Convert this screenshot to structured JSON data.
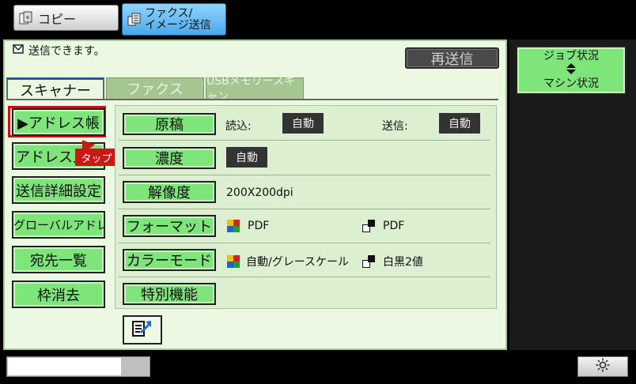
{
  "modes": {
    "copy_label": "コピー",
    "send_label_line1": "ファクス/",
    "send_label_line2": "イメージ送信"
  },
  "status": {
    "message": "送信できます。",
    "resend_label": "再送信"
  },
  "tabs": [
    {
      "label": "スキャナー",
      "active": true
    },
    {
      "label": "ファクス",
      "active": false
    },
    {
      "label": "USBメモリースキャン",
      "active": false
    }
  ],
  "side_buttons": [
    {
      "label": "▶アドレス帳",
      "highlighted": true
    },
    {
      "label": "アドレス入力"
    },
    {
      "label": "送信詳細設定"
    },
    {
      "label": "グローバルアドレス"
    },
    {
      "label": "宛先一覧"
    },
    {
      "label": "枠消去"
    }
  ],
  "tooltip": "タップ",
  "settings": {
    "original": {
      "label": "原稿",
      "read_label": "読込:",
      "read_value": "自動",
      "send_label": "送信:",
      "send_value": "自動"
    },
    "density": {
      "label": "濃度",
      "value": "自動"
    },
    "resolution": {
      "label": "解像度",
      "value": "200X200dpi"
    },
    "format": {
      "label": "フォーマット",
      "color_value": "PDF",
      "bw_value": "PDF"
    },
    "color_mode": {
      "label": "カラーモード",
      "color_value": "自動/グレースケール",
      "bw_value": "白黒2値"
    },
    "special": {
      "label": "特別機能"
    }
  },
  "right": {
    "job_status_line1": "ジョブ状況",
    "job_status_line2": "マシン状況"
  },
  "colors": {
    "button_green": "#7ee57a",
    "panel_bg": "#ebf9e2",
    "highlight_red": "#d01010",
    "send_blue": "#4aa9ea"
  },
  "icons": [
    "copy-icon",
    "fax-image-send-icon",
    "envelope-icon",
    "program-register-icon",
    "brightness-icon",
    "job-status-arrows-icon"
  ]
}
